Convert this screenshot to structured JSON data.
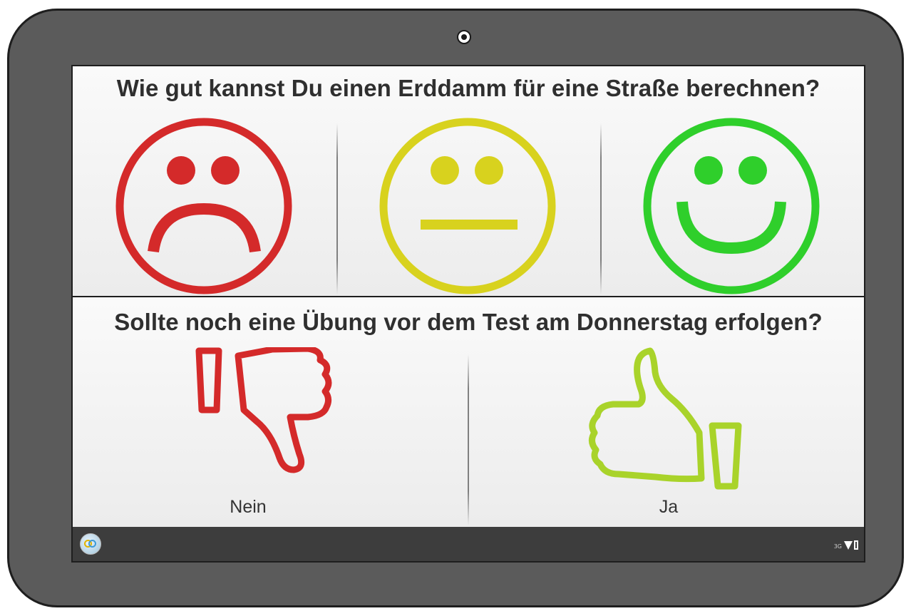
{
  "survey": {
    "question_1": "Wie gut kannst Du einen Erddamm für eine Straße berechnen?",
    "question_2": "Sollte noch eine Übung vor dem Test am Donnerstag erfolgen?",
    "ratings": [
      {
        "icon": "sad-face-icon",
        "color": "#d42a2a"
      },
      {
        "icon": "neutral-face-icon",
        "color": "#d8d21e"
      },
      {
        "icon": "happy-face-icon",
        "color": "#2fcf2b"
      }
    ],
    "answers": [
      {
        "label": "Nein",
        "icon": "thumbs-down-icon",
        "color": "#d42a2a"
      },
      {
        "label": "Ja",
        "icon": "thumbs-up-icon",
        "color": "#a9d32a"
      }
    ]
  },
  "status_bar": {
    "network_label": "3G",
    "home_icon": "home-app-icon",
    "signal_icon": "signal-icon",
    "battery_icon": "battery-icon"
  }
}
